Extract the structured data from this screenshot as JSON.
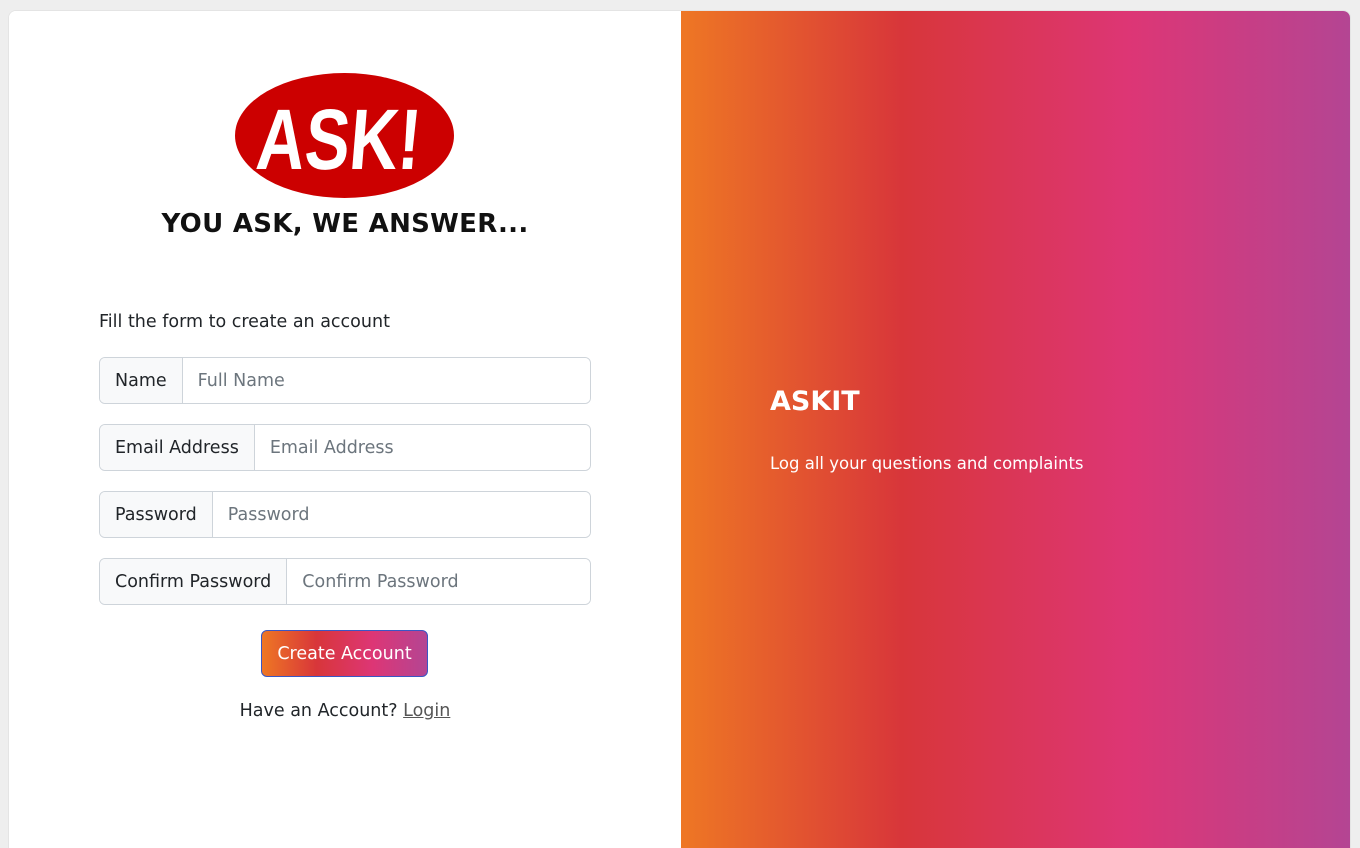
{
  "colors": {
    "page_bg": "#eeeeee",
    "gradient": [
      "#ee7724",
      "#d8363a",
      "#dd3675",
      "#b44593"
    ],
    "logo_red": "#cc0000"
  },
  "logo": {
    "text": "ASK!"
  },
  "tagline": "YOU ASK, WE ANSWER...",
  "form": {
    "intro": "Fill the form to create an account",
    "fields": [
      {
        "label": "Name",
        "placeholder": "Full Name",
        "value": ""
      },
      {
        "label": "Email Address",
        "placeholder": "Email Address",
        "value": ""
      },
      {
        "label": "Password",
        "placeholder": "Password",
        "value": ""
      },
      {
        "label": "Confirm Password",
        "placeholder": "Confirm Password",
        "value": ""
      }
    ],
    "submit_label": "Create Account",
    "login_prompt": "Have an Account?",
    "login_link": "Login"
  },
  "promo": {
    "title": "ASKIT",
    "description": "Log all your questions and complaints"
  }
}
